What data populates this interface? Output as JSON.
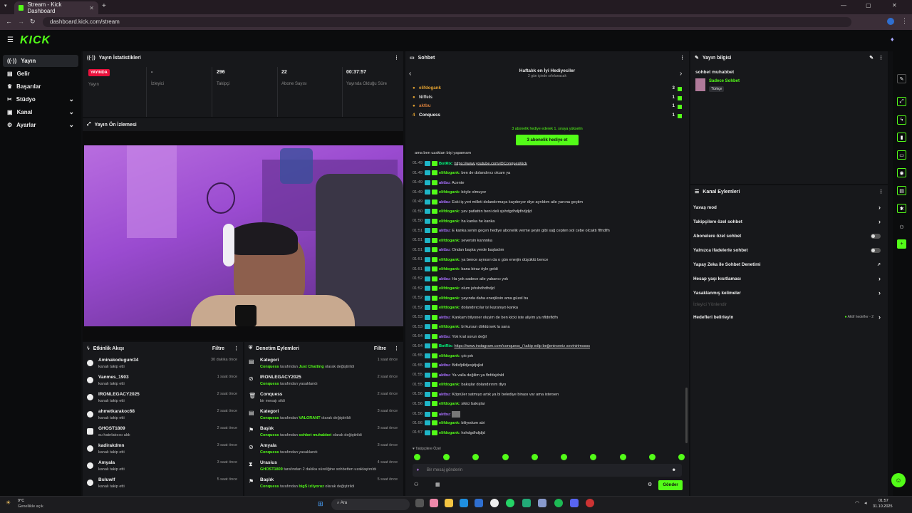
{
  "browser": {
    "tab_title": "Stream - Kick Dashboard",
    "url": "dashboard.kick.com/stream"
  },
  "app": {
    "logo": "KICK"
  },
  "sidebar": {
    "items": [
      {
        "label": "Yayın"
      },
      {
        "label": "Gelir"
      },
      {
        "label": "Başarılar"
      },
      {
        "label": "Stüdyo"
      },
      {
        "label": "Kanal"
      },
      {
        "label": "Ayarlar"
      }
    ]
  },
  "stats": {
    "title": "Yayın İstatistikleri",
    "live": "YAYINDA",
    "items": [
      {
        "value": "",
        "label": "Yayın"
      },
      {
        "value": "-",
        "label": "İzleyici"
      },
      {
        "value": "296",
        "label": "Takipçi"
      },
      {
        "value": "22",
        "label": "Abone Sayısı"
      },
      {
        "value": "00:37:57",
        "label": "Yayında Olduğu Süre"
      }
    ]
  },
  "preview": {
    "title": "Yayın Ön İzlemesi"
  },
  "activity": {
    "title": "Etkinlik Akışı",
    "filter": "Filtre",
    "items": [
      {
        "name": "Aminakodugum34",
        "sub": "kanalı takip etti",
        "time": "30 dakika önce"
      },
      {
        "name": "Vanmes_1903",
        "sub": "kanalı takip etti",
        "time": "1 saat önce"
      },
      {
        "name": "IRONLEGACY2025",
        "sub": "kanalı takip etti",
        "time": "2 saat önce"
      },
      {
        "name": "ahmetkarakoc68",
        "sub": "kanalı takip etti",
        "time": "2 saat önce"
      },
      {
        "name": "GHOST1809",
        "sub": "su hatırlatıcısı aldı",
        "time": "2 saat önce"
      },
      {
        "name": "kadirakdmn",
        "sub": "kanalı takip etti",
        "time": "3 saat önce"
      },
      {
        "name": "Amyala",
        "sub": "kanalı takip etti",
        "time": "3 saat önce"
      },
      {
        "name": "Buluwlf",
        "sub": "kanalı takip etti",
        "time": "5 saat önce"
      }
    ]
  },
  "moderation": {
    "title": "Denetim Eylemleri",
    "filter": "Filtre",
    "items": [
      {
        "name": "Kategori",
        "actor": "Conquess",
        "mid": " tarafından ",
        "obj": "Just Chatting",
        "end": " olarak değiştirildi",
        "time": "1 saat önce"
      },
      {
        "name": "IRONLEGACY2025",
        "actor": "Conquess",
        "mid": " tarafından yasaklandı",
        "obj": "",
        "end": "",
        "time": "2 saat önce"
      },
      {
        "name": "Conquess",
        "actor": "",
        "mid": "bir mesajı sildi",
        "obj": "",
        "end": "",
        "time": "2 saat önce"
      },
      {
        "name": "Kategori",
        "actor": "Conquess",
        "mid": " tarafından ",
        "obj": "VALORANT",
        "end": " olarak değiştirildi",
        "time": "3 saat önce"
      },
      {
        "name": "Başlık",
        "actor": "Conquess",
        "mid": " tarafından ",
        "obj": "sohbet muhabbet",
        "end": " olarak değiştirildi",
        "time": "3 saat önce"
      },
      {
        "name": "Amyala",
        "actor": "Conquess",
        "mid": " tarafından yasaklandı",
        "obj": "",
        "end": "",
        "time": "3 saat önce"
      },
      {
        "name": "Urasius",
        "actor": "GHOST1809",
        "mid": " tarafından 2 dakika süreliğine sohbetten uzaklaştırıldı",
        "obj": "",
        "end": "",
        "time": "4 saat önce"
      },
      {
        "name": "Başlık",
        "actor": "Conquess",
        "mid": " tarafından ",
        "obj": "bigS izliyoruz",
        "end": " olarak değiştirildi",
        "time": "5 saat önce"
      }
    ]
  },
  "chat": {
    "title": "Sohbet",
    "gifters_title": "Haftalık en İyi Hediyeciler",
    "gifters_sub": "2 gün içinde sıfırlanacak",
    "gifters": [
      {
        "rank": "",
        "name": "elifdogank",
        "count": "3"
      },
      {
        "rank": "",
        "name": "Niffels",
        "count": "1"
      },
      {
        "rank": "",
        "name": "aktbu",
        "count": "1"
      },
      {
        "rank": "4",
        "name": "Conquess",
        "count": "1"
      }
    ],
    "gift_hint": "3 abonelik hediye ederek 1. sıraya yükselin",
    "gift_button": "3 abonelik hediye et",
    "messages": [
      {
        "t": "",
        "u": "",
        "c": "",
        "m": "ama ben uzaktan bişi yapamam"
      },
      {
        "t": "01:49",
        "u": "BotRix:",
        "c": "u-b",
        "m": "https://www.youtube.com/@ConquesKick"
      },
      {
        "t": "01:49",
        "u": "elifdogank:",
        "c": "u-g",
        "m": "ben de dolandırıcı olcam ya"
      },
      {
        "t": "01:49",
        "u": "aktbu:",
        "c": "u-p",
        "m": "Acente"
      },
      {
        "t": "01:49",
        "u": "elifdogank:",
        "c": "u-g",
        "m": "böyle olmuyor"
      },
      {
        "t": "01:49",
        "u": "aktbu:",
        "c": "u-p",
        "m": "Eski iş yeri milleti dolandırmaya kaydınyor diye ayrıldım aile yanına geçtim"
      },
      {
        "t": "01:50",
        "u": "elifdogank:",
        "c": "u-g",
        "m": "yav patlattın beni deli sjshdgdhdjdhdjdjd"
      },
      {
        "t": "01:50",
        "u": "elifdogank:",
        "c": "u-g",
        "m": "ha kanka he kanka"
      },
      {
        "t": "01:51",
        "u": "aktbu:",
        "c": "u-p",
        "m": "E kanka senin geçen hediye abonelik verme şeyin gibi sağ cepten sol cebe olcaktı flfndlfn"
      },
      {
        "t": "01:51",
        "u": "elifdogank:",
        "c": "u-g",
        "m": "seversin kannnka"
      },
      {
        "t": "01:51",
        "u": "aktbu:",
        "c": "u-p",
        "m": "Ondan başka yerde başladım"
      },
      {
        "t": "01:51",
        "u": "elifdogank:",
        "c": "u-g",
        "m": "ya bence aynısın da o gün enerjin düşüktü bence"
      },
      {
        "t": "01:51",
        "u": "elifdogank:",
        "c": "u-g",
        "m": "bana biraz öyle geldi"
      },
      {
        "t": "01:52",
        "u": "aktbu:",
        "c": "u-p",
        "m": "Ha yok sadece aile yabancı yok"
      },
      {
        "t": "01:52",
        "u": "elifdogank:",
        "c": "u-g",
        "m": "olum jshshdhdhdjd"
      },
      {
        "t": "01:52",
        "u": "elifdogank:",
        "c": "u-g",
        "m": "yayında daha enerjiksin ama güzel bu"
      },
      {
        "t": "01:52",
        "u": "elifdogank:",
        "c": "u-g",
        "m": "dolandırıcılar iyi kazanıyo kanka"
      },
      {
        "t": "01:53",
        "u": "aktbu:",
        "c": "u-p",
        "m": "Kankam trilyoner oluyim de ben kicki iste aliyim ya nfldnfldfn"
      },
      {
        "t": "01:53",
        "u": "elifdogank:",
        "c": "u-g",
        "m": "bi kursun döktürsek la sana"
      },
      {
        "t": "01:54",
        "u": "aktbu:",
        "c": "u-p",
        "m": "Yok kral sorun değil"
      },
      {
        "t": "01:54",
        "u": "BotRix:",
        "c": "u-b",
        "m": "https://www.instagram.com/conquess_/ takip edip beğenirseniz sevinirimssss"
      },
      {
        "t": "01:55",
        "u": "elifdogank:",
        "c": "u-g",
        "m": "çıtı pıtı"
      },
      {
        "t": "01:55",
        "u": "aktbu:",
        "c": "u-p",
        "m": "Bdlsfjdldjesjdjsjkd"
      },
      {
        "t": "01:55",
        "u": "aktbu:",
        "c": "u-p",
        "m": "Ya valla değilim ya flnfdsjdnld"
      },
      {
        "t": "01:55",
        "u": "elifdogank:",
        "c": "u-g",
        "m": "bakışlar dolandırırım diyo"
      },
      {
        "t": "01:56",
        "u": "aktbu:",
        "c": "u-p",
        "m": "Köprüler satmıyo artık ya bi belediye binası var ama istersen"
      },
      {
        "t": "01:56",
        "u": "elifdogank:",
        "c": "u-g",
        "m": "sikici bakışlar"
      },
      {
        "t": "01:56",
        "u": "aktbu:",
        "c": "u-p",
        "m": ""
      },
      {
        "t": "01:56",
        "u": "elifdogank:",
        "c": "u-g",
        "m": "biliyodum abi"
      },
      {
        "t": "01:57",
        "u": "elifdogank:",
        "c": "u-g",
        "m": "hshdgdhdjdjd"
      }
    ],
    "followers_only": "Takipçilere Özel",
    "placeholder": "Bir mesaj gönderin",
    "send": "Gönder"
  },
  "stream_info": {
    "title": "Yayın bilgisi",
    "stream_title": "sohbet muhabbet",
    "category": "Sadece Sohbet",
    "lang": "Türkçe"
  },
  "channel_actions": {
    "title": "Kanal Eylemleri",
    "items": [
      {
        "label": "Yavaş mod",
        "kind": "arrow"
      },
      {
        "label": "Takipçilere özel sohbet",
        "kind": "arrow"
      },
      {
        "label": "Abonelere özel sohbet",
        "kind": "toggle"
      },
      {
        "label": "Yalnızca ifadelerle sohbet",
        "kind": "toggle"
      },
      {
        "label": "Yapay Zeka ile Sohbet Denetimi",
        "kind": "ext"
      },
      {
        "label": "Hesap yaşı kısıtlaması",
        "kind": "arrow"
      },
      {
        "label": "Yasaklanmış kelimeler",
        "kind": "arrow"
      }
    ],
    "disabled": "İzleyici Yönlendir",
    "goals": "Hedefleri belirleyin",
    "goals_status": "Aktif hedefler - 2"
  },
  "taskbar": {
    "weather_temp": "9°C",
    "weather_desc": "Genellikle açık",
    "search": "Ara",
    "time": "01:57",
    "date": "31.10.2025"
  },
  "colors": {
    "accent": "#53fc18",
    "live": "#e9113c",
    "user_green": "#53fc18",
    "user_purple": "#a970ff",
    "bot": "#00ff80"
  }
}
